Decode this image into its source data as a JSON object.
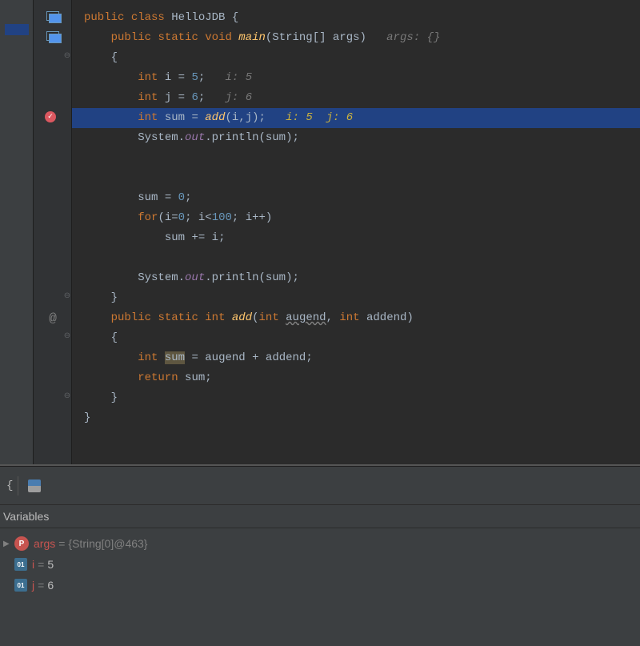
{
  "code": {
    "lines": [
      {
        "indent": 0,
        "tokens": [
          [
            "kw",
            "public"
          ],
          [
            "sp",
            " "
          ],
          [
            "kw",
            "class"
          ],
          [
            "sp",
            " "
          ],
          [
            "class-name",
            "HelloJDB"
          ],
          [
            "sp",
            " "
          ],
          [
            "punct",
            "{"
          ]
        ]
      },
      {
        "indent": 1,
        "tokens": [
          [
            "kw",
            "public"
          ],
          [
            "sp",
            " "
          ],
          [
            "kw",
            "static"
          ],
          [
            "sp",
            " "
          ],
          [
            "kw",
            "void"
          ],
          [
            "sp",
            " "
          ],
          [
            "method",
            "main"
          ],
          [
            "punct",
            "("
          ],
          [
            "param",
            "String[] args"
          ],
          [
            "punct",
            ")"
          ],
          [
            "sp",
            "   "
          ],
          [
            "hint",
            "args: {}"
          ]
        ]
      },
      {
        "indent": 1,
        "tokens": [
          [
            "punct",
            "{"
          ]
        ]
      },
      {
        "indent": 2,
        "tokens": [
          [
            "type",
            "int"
          ],
          [
            "sp",
            " "
          ],
          [
            "param",
            "i"
          ],
          [
            "sp",
            " "
          ],
          [
            "punct",
            "="
          ],
          [
            "sp",
            " "
          ],
          [
            "num",
            "5"
          ],
          [
            "punct",
            ";"
          ],
          [
            "sp",
            "   "
          ],
          [
            "hint",
            "i: 5"
          ]
        ]
      },
      {
        "indent": 2,
        "tokens": [
          [
            "type",
            "int"
          ],
          [
            "sp",
            " "
          ],
          [
            "param",
            "j"
          ],
          [
            "sp",
            " "
          ],
          [
            "punct",
            "="
          ],
          [
            "sp",
            " "
          ],
          [
            "num",
            "6"
          ],
          [
            "punct",
            ";"
          ],
          [
            "sp",
            "   "
          ],
          [
            "hint",
            "j: 6"
          ]
        ]
      },
      {
        "indent": 2,
        "highlighted": true,
        "tokens": [
          [
            "type",
            "int"
          ],
          [
            "sp",
            " "
          ],
          [
            "param",
            "sum"
          ],
          [
            "sp",
            " "
          ],
          [
            "punct",
            "="
          ],
          [
            "sp",
            " "
          ],
          [
            "method",
            "add"
          ],
          [
            "punct",
            "("
          ],
          [
            "param",
            "i"
          ],
          [
            "punct",
            ","
          ],
          [
            "param",
            "j"
          ],
          [
            "punct",
            ")"
          ],
          [
            "punct",
            ";"
          ],
          [
            "sp",
            "   "
          ],
          [
            "hint-hl",
            "i: 5  j: 6"
          ]
        ]
      },
      {
        "indent": 2,
        "tokens": [
          [
            "param",
            "System."
          ],
          [
            "field",
            "out"
          ],
          [
            "punct",
            "."
          ],
          [
            "param",
            "println"
          ],
          [
            "punct",
            "("
          ],
          [
            "param",
            "sum"
          ],
          [
            "punct",
            ")"
          ],
          [
            "punct",
            ";"
          ]
        ]
      },
      {
        "indent": 0,
        "tokens": []
      },
      {
        "indent": 0,
        "tokens": []
      },
      {
        "indent": 2,
        "tokens": [
          [
            "param",
            "sum"
          ],
          [
            "sp",
            " "
          ],
          [
            "punct",
            "="
          ],
          [
            "sp",
            " "
          ],
          [
            "num",
            "0"
          ],
          [
            "punct",
            ";"
          ]
        ]
      },
      {
        "indent": 2,
        "tokens": [
          [
            "kw",
            "for"
          ],
          [
            "punct",
            "("
          ],
          [
            "param",
            "i"
          ],
          [
            "punct",
            "="
          ],
          [
            "num",
            "0"
          ],
          [
            "punct",
            ";"
          ],
          [
            "sp",
            " "
          ],
          [
            "param",
            "i"
          ],
          [
            "punct",
            "<"
          ],
          [
            "num",
            "100"
          ],
          [
            "punct",
            ";"
          ],
          [
            "sp",
            " "
          ],
          [
            "param",
            "i"
          ],
          [
            "punct",
            "++)"
          ]
        ]
      },
      {
        "indent": 3,
        "tokens": [
          [
            "param",
            "sum"
          ],
          [
            "sp",
            " "
          ],
          [
            "punct",
            "+="
          ],
          [
            "sp",
            " "
          ],
          [
            "param",
            "i"
          ],
          [
            "punct",
            ";"
          ]
        ]
      },
      {
        "indent": 0,
        "tokens": []
      },
      {
        "indent": 2,
        "tokens": [
          [
            "param",
            "System."
          ],
          [
            "field",
            "out"
          ],
          [
            "punct",
            "."
          ],
          [
            "param",
            "println"
          ],
          [
            "punct",
            "("
          ],
          [
            "param",
            "sum"
          ],
          [
            "punct",
            ")"
          ],
          [
            "punct",
            ";"
          ]
        ]
      },
      {
        "indent": 1,
        "tokens": [
          [
            "punct",
            "}"
          ]
        ]
      },
      {
        "indent": 1,
        "tokens": [
          [
            "kw",
            "public"
          ],
          [
            "sp",
            " "
          ],
          [
            "kw",
            "static"
          ],
          [
            "sp",
            " "
          ],
          [
            "type",
            "int"
          ],
          [
            "sp",
            " "
          ],
          [
            "method",
            "add"
          ],
          [
            "punct",
            "("
          ],
          [
            "type",
            "int"
          ],
          [
            "sp",
            " "
          ],
          [
            "underline-wavy",
            "augend"
          ],
          [
            "punct",
            ","
          ],
          [
            "sp",
            " "
          ],
          [
            "type",
            "int"
          ],
          [
            "sp",
            " "
          ],
          [
            "param",
            "addend"
          ],
          [
            "punct",
            ")"
          ]
        ]
      },
      {
        "indent": 1,
        "tokens": [
          [
            "punct",
            "{"
          ]
        ]
      },
      {
        "indent": 2,
        "tokens": [
          [
            "type",
            "int"
          ],
          [
            "sp",
            " "
          ],
          [
            "var-highlight",
            "sum"
          ],
          [
            "sp",
            " "
          ],
          [
            "punct",
            "="
          ],
          [
            "sp",
            " "
          ],
          [
            "param",
            "augend"
          ],
          [
            "sp",
            " "
          ],
          [
            "punct",
            "+"
          ],
          [
            "sp",
            " "
          ],
          [
            "param",
            "addend"
          ],
          [
            "punct",
            ";"
          ]
        ]
      },
      {
        "indent": 2,
        "tokens": [
          [
            "kw",
            "return"
          ],
          [
            "sp",
            " "
          ],
          [
            "param",
            "sum"
          ],
          [
            "punct",
            ";"
          ]
        ]
      },
      {
        "indent": 1,
        "tokens": [
          [
            "punct",
            "}"
          ]
        ]
      },
      {
        "indent": 0,
        "tokens": [
          [
            "punct",
            "}"
          ]
        ]
      }
    ]
  },
  "gutter": {
    "icons": [
      {
        "type": "stack",
        "line": 1
      },
      {
        "type": "stack",
        "line": 2
      },
      {
        "type": "fold-open",
        "line": 3
      },
      {
        "type": "breakpoint",
        "line": 6
      },
      {
        "type": "fold-close",
        "line": 15
      },
      {
        "type": "at",
        "line": 16
      },
      {
        "type": "fold-open",
        "line": 17
      },
      {
        "type": "fold-close",
        "line": 20
      }
    ]
  },
  "debug": {
    "panel_title": "Variables",
    "variables": [
      {
        "icon": "param",
        "icon_text": "P",
        "name": "args",
        "value": "{String[0]@463}",
        "expandable": true,
        "numeric": false
      },
      {
        "icon": "primitive",
        "icon_text": "01",
        "name": "i",
        "value": "5",
        "expandable": false,
        "numeric": true
      },
      {
        "icon": "primitive",
        "icon_text": "01",
        "name": "j",
        "value": "6",
        "expandable": false,
        "numeric": true
      }
    ]
  }
}
